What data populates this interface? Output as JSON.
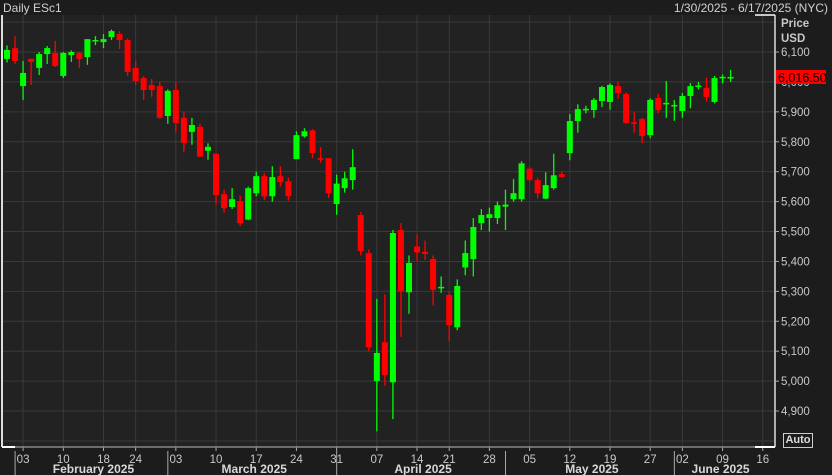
{
  "header": {
    "title": "Daily ESc1",
    "range": "1/30/2025 - 6/17/2025 (NYC)"
  },
  "auto_label": "Auto",
  "colors": {
    "up": "#00ff00",
    "down": "#ff0000",
    "last_bg": "#ff0000"
  },
  "chart_data": {
    "type": "candlestick",
    "title": "Daily ESc1",
    "ylabel": "Price USD",
    "ylabel_lines": [
      "Price",
      "USD"
    ],
    "ylim": [
      4800,
      6200
    ],
    "yticks": [
      4900,
      5000,
      5100,
      5200,
      5300,
      5400,
      5500,
      5600,
      5700,
      5800,
      5900,
      6000,
      6100
    ],
    "last_price": "6,016.50",
    "grid": true,
    "ohlc": [
      [
        "2025-01-30",
        6077,
        6122,
        6065,
        6107
      ],
      [
        "2025-01-31",
        6113,
        6153,
        6060,
        6070
      ],
      [
        "2025-02-03",
        5986,
        6070,
        5940,
        6030
      ],
      [
        "2025-02-04",
        6077,
        6078,
        5990,
        6067
      ],
      [
        "2025-02-05",
        6047,
        6100,
        6023,
        6093
      ],
      [
        "2025-02-06",
        6093,
        6120,
        6060,
        6113
      ],
      [
        "2025-02-07",
        6097,
        6137,
        6050,
        6053
      ],
      [
        "2025-02-10",
        6020,
        6100,
        6013,
        6097
      ],
      [
        "2025-02-11",
        6090,
        6105,
        6067,
        6100
      ],
      [
        "2025-02-12",
        6097,
        6100,
        6047,
        6077
      ],
      [
        "2025-02-13",
        6083,
        6143,
        6057,
        6143
      ],
      [
        "2025-02-14",
        6137,
        6153,
        6123,
        6140
      ],
      [
        "2025-02-18",
        6133,
        6160,
        6113,
        6143
      ],
      [
        "2025-02-19",
        6150,
        6175,
        6140,
        6170
      ],
      [
        "2025-02-20",
        6160,
        6170,
        6110,
        6140
      ],
      [
        "2025-02-21",
        6140,
        6145,
        6020,
        6033
      ],
      [
        "2025-02-24",
        6047,
        6070,
        5990,
        6003
      ],
      [
        "2025-02-25",
        6013,
        6020,
        5940,
        5973
      ],
      [
        "2025-02-26",
        5990,
        6010,
        5950,
        5973
      ],
      [
        "2025-02-27",
        5986,
        6000,
        5877,
        5880
      ],
      [
        "2025-02-28",
        5886,
        5975,
        5860,
        5970
      ],
      [
        "2025-03-03",
        5973,
        6000,
        5830,
        5863
      ],
      [
        "2025-03-04",
        5880,
        5900,
        5765,
        5796
      ],
      [
        "2025-03-05",
        5833,
        5880,
        5790,
        5856
      ],
      [
        "2025-03-06",
        5850,
        5860,
        5750,
        5750
      ],
      [
        "2025-03-07",
        5770,
        5795,
        5740,
        5783
      ],
      [
        "2025-03-10",
        5760,
        5760,
        5590,
        5622
      ],
      [
        "2025-03-11",
        5625,
        5640,
        5563,
        5578
      ],
      [
        "2025-03-12",
        5582,
        5645,
        5575,
        5608
      ],
      [
        "2025-03-13",
        5602,
        5620,
        5518,
        5528
      ],
      [
        "2025-03-14",
        5540,
        5650,
        5538,
        5645
      ],
      [
        "2025-03-17",
        5628,
        5700,
        5618,
        5685
      ],
      [
        "2025-03-18",
        5685,
        5695,
        5605,
        5618
      ],
      [
        "2025-03-19",
        5618,
        5718,
        5600,
        5682
      ],
      [
        "2025-03-20",
        5685,
        5718,
        5650,
        5665
      ],
      [
        "2025-03-21",
        5668,
        5680,
        5603,
        5618
      ],
      [
        "2025-03-24",
        5742,
        5835,
        5742,
        5822
      ],
      [
        "2025-03-25",
        5818,
        5845,
        5814,
        5835
      ],
      [
        "2025-03-26",
        5838,
        5842,
        5745,
        5762
      ],
      [
        "2025-03-27",
        5745,
        5782,
        5730,
        5740
      ],
      [
        "2025-03-28",
        5745,
        5745,
        5612,
        5628
      ],
      [
        "2025-03-31",
        5592,
        5690,
        5556,
        5660
      ],
      [
        "2025-04-01",
        5645,
        5700,
        5630,
        5678
      ],
      [
        "2025-04-02",
        5672,
        5775,
        5640,
        5715
      ],
      [
        "2025-04-03",
        5555,
        5565,
        5420,
        5435
      ],
      [
        "2025-04-04",
        5428,
        5440,
        5100,
        5113
      ],
      [
        "2025-04-07",
        5000,
        5275,
        4832,
        5094
      ],
      [
        "2025-04-08",
        5130,
        5290,
        4985,
        5020
      ],
      [
        "2025-04-09",
        4996,
        5505,
        4873,
        5495
      ],
      [
        "2025-04-10",
        5505,
        5528,
        5147,
        5300
      ],
      [
        "2025-04-11",
        5297,
        5420,
        5225,
        5395
      ],
      [
        "2025-04-14",
        5450,
        5490,
        5400,
        5430
      ],
      [
        "2025-04-15",
        5432,
        5470,
        5405,
        5425
      ],
      [
        "2025-04-16",
        5408,
        5420,
        5253,
        5305
      ],
      [
        "2025-04-17",
        5312,
        5350,
        5295,
        5315
      ],
      [
        "2025-04-21",
        5288,
        5300,
        5135,
        5187
      ],
      [
        "2025-04-22",
        5180,
        5340,
        5170,
        5318
      ],
      [
        "2025-04-23",
        5380,
        5470,
        5354,
        5428
      ],
      [
        "2025-04-24",
        5408,
        5545,
        5350,
        5515
      ],
      [
        "2025-04-25",
        5528,
        5575,
        5505,
        5555
      ],
      [
        "2025-04-28",
        5545,
        5580,
        5500,
        5558
      ],
      [
        "2025-04-29",
        5545,
        5600,
        5525,
        5588
      ],
      [
        "2025-04-30",
        5583,
        5640,
        5505,
        5590
      ],
      [
        "2025-05-01",
        5608,
        5675,
        5600,
        5628
      ],
      [
        "2025-05-02",
        5608,
        5735,
        5600,
        5728
      ],
      [
        "2025-05-05",
        5710,
        5715,
        5665,
        5672
      ],
      [
        "2025-05-06",
        5672,
        5680,
        5610,
        5628
      ],
      [
        "2025-05-07",
        5610,
        5698,
        5608,
        5655
      ],
      [
        "2025-05-08",
        5645,
        5760,
        5640,
        5688
      ],
      [
        "2025-05-09",
        5692,
        5700,
        5680,
        5682
      ],
      [
        "2025-05-12",
        5762,
        5893,
        5738,
        5869
      ],
      [
        "2025-05-13",
        5869,
        5925,
        5830,
        5909
      ],
      [
        "2025-05-14",
        5905,
        5920,
        5895,
        5910
      ],
      [
        "2025-05-15",
        5906,
        5946,
        5880,
        5940
      ],
      [
        "2025-05-16",
        5936,
        5987,
        5916,
        5983
      ],
      [
        "2025-05-19",
        5933,
        5995,
        5907,
        5990
      ],
      [
        "2025-05-20",
        5986,
        6000,
        5943,
        5963
      ],
      [
        "2025-05-21",
        5960,
        5965,
        5859,
        5863
      ],
      [
        "2025-05-22",
        5865,
        5900,
        5830,
        5862
      ],
      [
        "2025-05-23",
        5876,
        5880,
        5795,
        5819
      ],
      [
        "2025-05-27",
        5822,
        5945,
        5812,
        5940
      ],
      [
        "2025-05-28",
        5946,
        5960,
        5895,
        5906
      ],
      [
        "2025-05-29",
        5929,
        6003,
        5880,
        5930
      ],
      [
        "2025-05-30",
        5920,
        5940,
        5870,
        5923
      ],
      [
        "2025-06-02",
        5903,
        5963,
        5880,
        5953
      ],
      [
        "2025-06-03",
        5953,
        5996,
        5912,
        5986
      ],
      [
        "2025-06-04",
        5985,
        6000,
        5975,
        5988
      ],
      [
        "2025-06-05",
        5980,
        6015,
        5935,
        5950
      ],
      [
        "2025-06-06",
        5933,
        6020,
        5928,
        6013
      ],
      [
        "2025-06-09",
        6015,
        6025,
        5995,
        6017
      ],
      [
        "2025-06-10",
        6016,
        6040,
        6000,
        6016.5
      ]
    ],
    "xticks": [
      {
        "label": "03",
        "date": "2025-02-03"
      },
      {
        "label": "10",
        "date": "2025-02-10"
      },
      {
        "label": "18",
        "date": "2025-02-18"
      },
      {
        "label": "24",
        "date": "2025-02-24"
      },
      {
        "label": "03",
        "date": "2025-03-03"
      },
      {
        "label": "10",
        "date": "2025-03-10"
      },
      {
        "label": "17",
        "date": "2025-03-17"
      },
      {
        "label": "24",
        "date": "2025-03-24"
      },
      {
        "label": "31",
        "date": "2025-03-31"
      },
      {
        "label": "07",
        "date": "2025-04-07"
      },
      {
        "label": "14",
        "date": "2025-04-14"
      },
      {
        "label": "21",
        "date": "2025-04-21"
      },
      {
        "label": "28",
        "date": "2025-04-28"
      },
      {
        "label": "05",
        "date": "2025-05-05"
      },
      {
        "label": "12",
        "date": "2025-05-12"
      },
      {
        "label": "19",
        "date": "2025-05-19"
      },
      {
        "label": "27",
        "date": "2025-05-27"
      },
      {
        "label": "02",
        "date": "2025-06-02"
      },
      {
        "label": "09",
        "date": "2025-06-09"
      },
      {
        "label": "16",
        "date": "2025-06-16"
      }
    ],
    "months": [
      {
        "label": "February 2025",
        "start": "2025-02-03",
        "end": "2025-02-28"
      },
      {
        "label": "March 2025",
        "start": "2025-03-03",
        "end": "2025-03-31"
      },
      {
        "label": "April 2025",
        "start": "2025-04-01",
        "end": "2025-04-30"
      },
      {
        "label": "May 2025",
        "start": "2025-05-01",
        "end": "2025-05-30"
      },
      {
        "label": "June 2025",
        "start": "2025-06-02",
        "end": "2025-06-16"
      }
    ]
  }
}
